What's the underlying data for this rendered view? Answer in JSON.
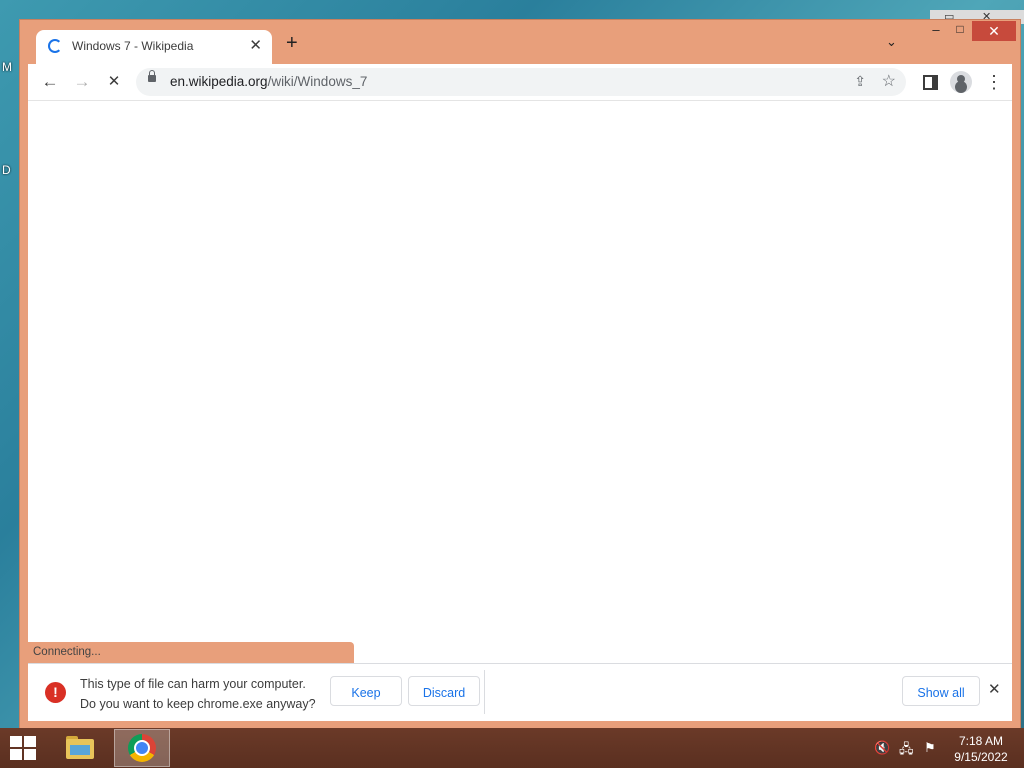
{
  "desktop": {
    "label_m": "M",
    "label_d": "D"
  },
  "tab": {
    "title": "Windows 7 - Wikipedia",
    "close_glyph": "✕"
  },
  "titlebar": {
    "new_tab_glyph": "+",
    "tab_search_glyph": "⌄",
    "minimize_glyph": "–",
    "maximize_glyph": "□",
    "close_glyph": "✕"
  },
  "toolbar": {
    "back_glyph": "←",
    "forward_glyph": "→",
    "stop_glyph": "✕",
    "menu_glyph": "⋮"
  },
  "omnibox": {
    "domain": "en.wikipedia.org",
    "path": "/wiki/Windows_7",
    "share_glyph": "⇪",
    "star_glyph": "☆"
  },
  "status": {
    "text": "Connecting..."
  },
  "download_shelf": {
    "warning_glyph": "!",
    "line1": "This type of file can harm your computer.",
    "line2": "Do you want to keep chrome.exe anyway?",
    "keep_label": "Keep",
    "discard_label": "Discard",
    "show_all_label": "Show all",
    "close_glyph": "✕"
  },
  "taskbar": {
    "time": "7:18 AM",
    "date": "9/15/2022",
    "volume_glyph": "🔇",
    "network_glyph": "🖧",
    "flag_glyph": "⚑"
  },
  "colors": {
    "frame": "#e89f7b",
    "close_button": "#c74a3c",
    "accent": "#1a73e8",
    "warning": "#d93025",
    "taskbar": "#5a2f20"
  }
}
